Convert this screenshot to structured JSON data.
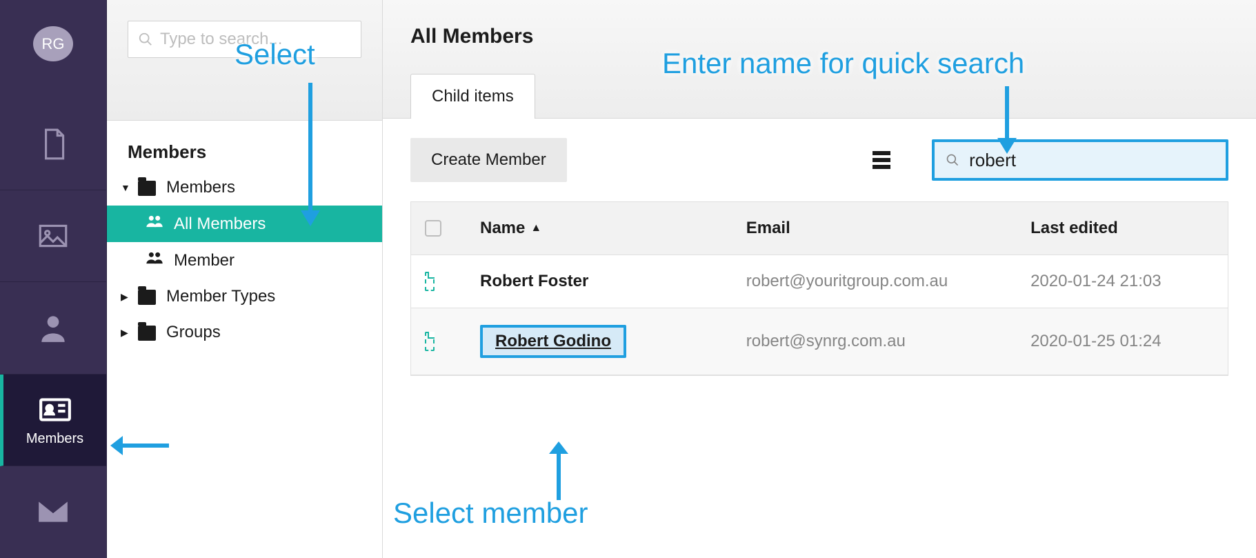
{
  "rail": {
    "avatar_initials": "RG",
    "members_label": "Members"
  },
  "tree": {
    "search_placeholder": "Type to search...",
    "heading": "Members",
    "nodes": {
      "members": "Members",
      "all_members": "All Members",
      "member": "Member",
      "member_types": "Member Types",
      "groups": "Groups"
    }
  },
  "main": {
    "title": "All Members",
    "tab_label": "Child items",
    "create_button": "Create Member",
    "search_value": "robert",
    "columns": {
      "name": "Name",
      "email": "Email",
      "last_edited": "Last edited"
    },
    "rows": [
      {
        "name": "Robert Foster",
        "email": "robert@youritgroup.com.au",
        "last_edited": "2020-01-24 21:03"
      },
      {
        "name": "Robert Godino",
        "email": "robert@synrg.com.au",
        "last_edited": "2020-01-25 01:24"
      }
    ]
  },
  "annotations": {
    "select": "Select",
    "enter_name": "Enter name for quick search",
    "select_member": "Select member"
  }
}
